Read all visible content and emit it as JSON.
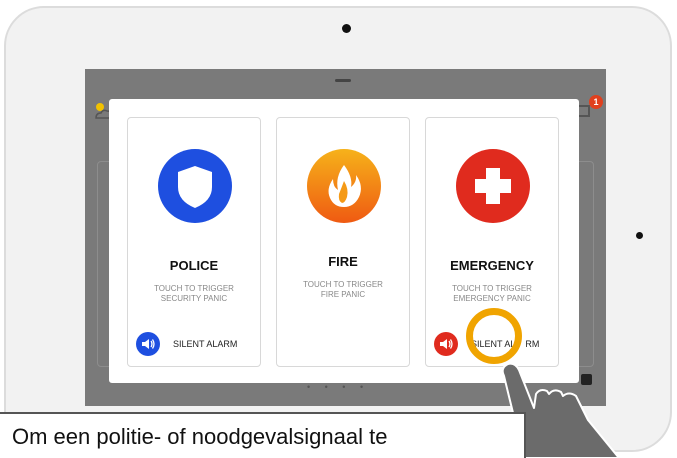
{
  "modal": {
    "cards": [
      {
        "title": "POLICE",
        "desc_line1": "TOUCH TO TRIGGER",
        "desc_line2": "SECURITY PANIC",
        "icon": "shield-icon",
        "color": "#1e4fe0"
      },
      {
        "title": "FIRE",
        "desc_line1": "TOUCH TO TRIGGER",
        "desc_line2": "FIRE PANIC",
        "icon": "flame-icon",
        "color": "#f07a12"
      },
      {
        "title": "EMERGENCY",
        "desc_line1": "TOUCH TO TRIGGER",
        "desc_line2": "EMERGENCY PANIC",
        "icon": "medical-cross-icon",
        "color": "#e02b1e"
      }
    ],
    "police_silent_label": "SILENT ALARM",
    "emergency_silent_label": "SILENT AL",
    "emergency_silent_label_tail": "RM"
  },
  "header": {
    "notification_count": "1"
  },
  "caption": {
    "text": "Om een politie- of noodgevalsignaal te"
  },
  "colors": {
    "highlight_ring": "#f0a400",
    "screen_bg": "#7a7a7a",
    "hand": "#6b6b6b"
  }
}
